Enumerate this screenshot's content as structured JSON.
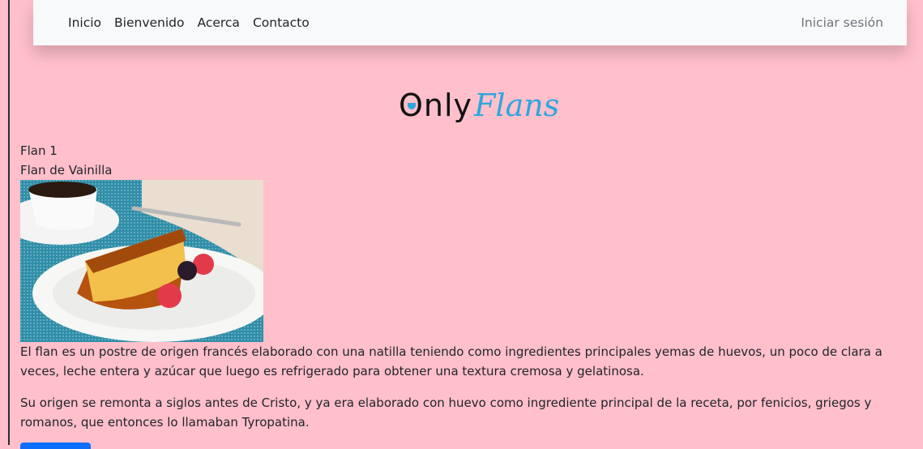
{
  "nav": {
    "links": [
      "Inicio",
      "Bienvenido",
      "Acerca",
      "Contacto"
    ],
    "login": "Iniciar sesión"
  },
  "logo": {
    "part1": "Only",
    "part2": "Flans"
  },
  "flan": {
    "number": "Flan 1",
    "name": "Flan de Vainilla",
    "paragraph1": "El flan es un postre de origen francés elaborado con una natilla teniendo como ingredientes principales yemas de huevos, un poco de clara a veces, leche entera y azúcar que luego es refrigerado para obtener una textura cremosa y gelatinosa.",
    "paragraph2": "Su origen se remonta a siglos antes de Cristo, y ya era elaborado con huevo como ingrediente principal de la receta, por fenicios, griegos y romanos, que entonces lo llamaban Tyropatina."
  },
  "colors": {
    "background": "#ffbfcb",
    "navbar": "#f8f9fa",
    "brand_blue": "#2aa7e0",
    "button": "#0d6efd"
  }
}
